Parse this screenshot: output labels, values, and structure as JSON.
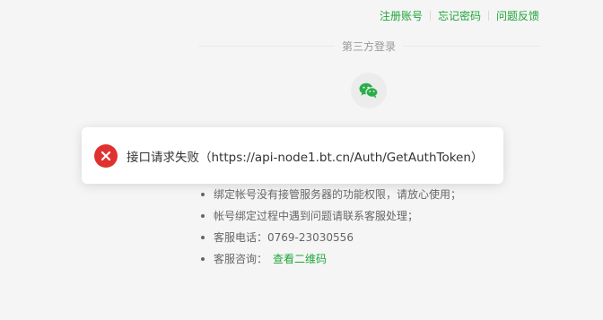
{
  "header_links": {
    "register": "注册账号",
    "forgot_password": "忘记密码",
    "feedback": "问题反馈"
  },
  "third_party": {
    "label": "第三方登录",
    "wechat_icon": "wechat-icon"
  },
  "toast": {
    "icon": "error-icon",
    "message": "接口请求失败（https://api-node1.bt.cn/Auth/GetAuthToken）"
  },
  "notes": {
    "item1": "绑定帐号没有接管服务器的功能权限，请放心使用；",
    "item2": "帐号绑定过程中遇到问题请联系客服处理；",
    "item3": "客服电话：0769-23030556",
    "item4_label": "客服咨询：",
    "item4_link": "查看二维码"
  },
  "colors": {
    "accent": "#20a53a",
    "error": "#e03131",
    "background": "#f5f5f5"
  }
}
